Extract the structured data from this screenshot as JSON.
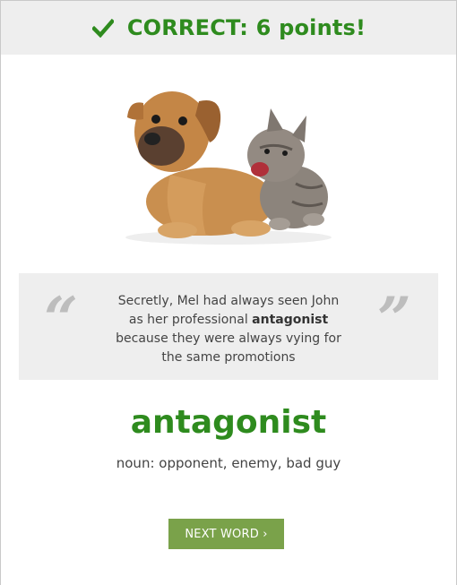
{
  "banner": {
    "icon": "check-icon",
    "text": "CORRECT: 6 points!",
    "color": "#2e8b1e"
  },
  "image": {
    "subject": "puppy-and-kitten-photo"
  },
  "quote": {
    "open_mark": "“",
    "close_mark": "”",
    "before": "Secretly, Mel had always seen John as her professional ",
    "highlight": "antagonist",
    "after": " because they were always vying for the same promotions"
  },
  "word": {
    "text": "antagonist",
    "definition": "noun: opponent, enemy, bad guy"
  },
  "next_button": {
    "label": "NEXT WORD ›",
    "color": "#7aa24a"
  }
}
